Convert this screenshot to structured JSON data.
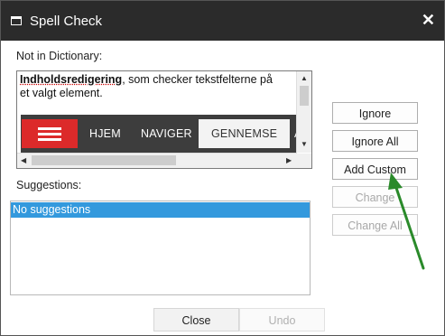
{
  "window": {
    "title": "Spell Check",
    "close_glyph": "✕"
  },
  "not_in_dictionary": {
    "label": "Not in Dictionary:",
    "word": "Indholdsredigering",
    "text_rest_line1": ", som checker tekstfelterne på",
    "text_line2": "et valgt element."
  },
  "preview_nav": {
    "items": [
      "HJEM",
      "NAVIGER",
      "GENNEMSE",
      "A"
    ],
    "active_item": "GENNEMSE",
    "menu_color": "#dc2a2a",
    "bar_color": "#3d3d3d"
  },
  "suggestions": {
    "label": "Suggestions:",
    "items": [
      "No suggestions"
    ],
    "selected_color": "#3399dd"
  },
  "buttons": {
    "ignore": "Ignore",
    "ignore_all": "Ignore All",
    "add_custom": "Add Custom",
    "change": "Change",
    "change_all": "Change All",
    "close": "Close",
    "undo": "Undo"
  },
  "annotation": {
    "arrow_color": "#2a8a2a",
    "points_to": "add_custom"
  }
}
